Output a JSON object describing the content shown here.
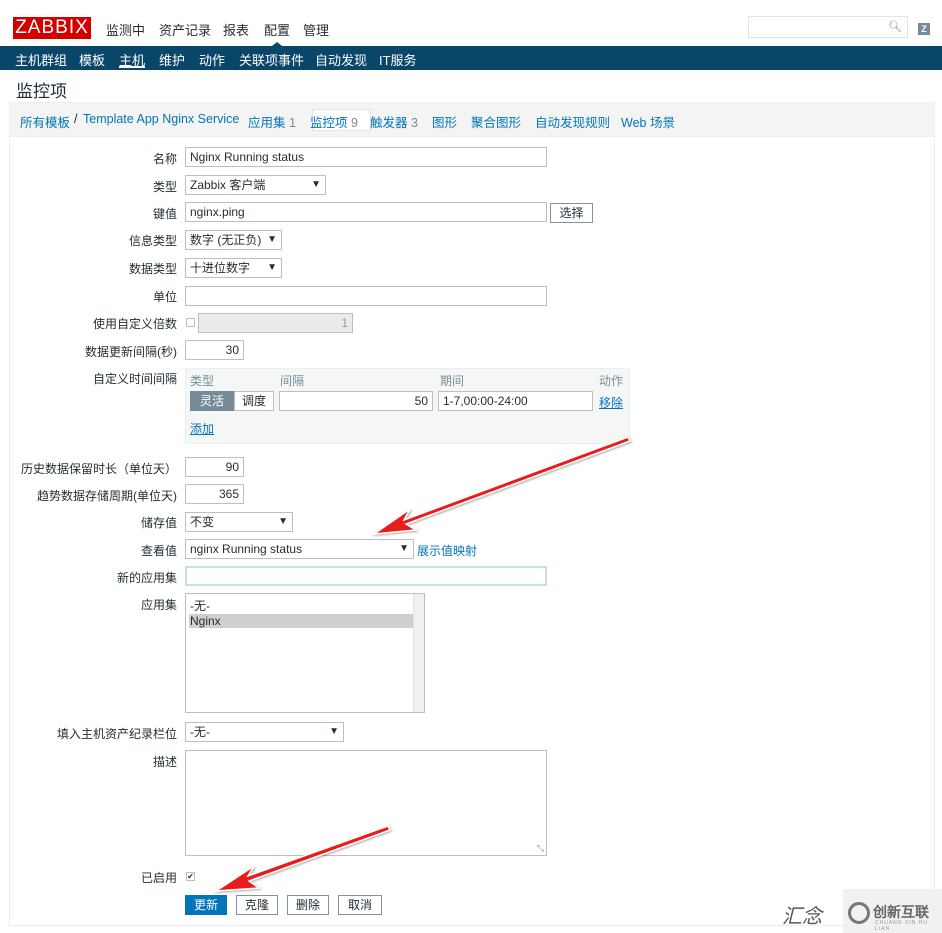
{
  "header": {
    "logo": "ZABBIX",
    "nav": [
      "监测中",
      "资产记录",
      "报表",
      "配置",
      "管理"
    ],
    "search_placeholder": "",
    "help_label": "Z"
  },
  "subnav": [
    "主机群组",
    "模板",
    "主机",
    "维护",
    "动作",
    "关联项事件",
    "自动发现",
    "IT服务"
  ],
  "page_title": "监控项",
  "breadcrumb": {
    "all_templates": "所有模板",
    "separator": "/",
    "template": "Template App Nginx Service",
    "app_set": "应用集",
    "app_set_count": "1",
    "items": "监控项",
    "items_count": "9",
    "triggers": "触发器",
    "triggers_count": "3",
    "graphs": "图形",
    "screens": "聚合图形",
    "discovery": "自动发现规则",
    "web": "Web 场景"
  },
  "form": {
    "name_label": "名称",
    "name_value": "Nginx Running status",
    "type_label": "类型",
    "type_value": "Zabbix 客户端",
    "key_label": "键值",
    "key_value": "nginx.ping",
    "key_select_button": "选择",
    "info_type_label": "信息类型",
    "info_type_value": "数字 (无正负)",
    "data_type_label": "数据类型",
    "data_type_value": "十进位数字",
    "units_label": "单位",
    "units_value": "",
    "multiplier_label": "使用自定义倍数",
    "multiplier_value": "1",
    "interval_label": "数据更新间隔(秒)",
    "interval_value": "30",
    "custom_intervals_label": "自定义时间间隔",
    "ci_head_type": "类型",
    "ci_head_interval": "间隔",
    "ci_head_period": "期间",
    "ci_head_action": "动作",
    "ci_flexible": "灵活",
    "ci_scheduling": "调度",
    "ci_interval_value": "50",
    "ci_period_value": "1-7,00:00-24:00",
    "ci_remove": "移除",
    "ci_add": "添加",
    "history_label": "历史数据保留时长（单位天）",
    "history_value": "90",
    "trends_label": "趋势数据存储周期(单位天)",
    "trends_value": "365",
    "store_label": "储存值",
    "store_value": "不变",
    "show_value_label": "查看值",
    "show_value_value": "nginx Running status",
    "value_mapping_link": "展示值映射",
    "new_app_label": "新的应用集",
    "new_app_value": "",
    "apps_label": "应用集",
    "apps_options": [
      "-无-",
      "Nginx"
    ],
    "inventory_label": "填入主机资产纪录栏位",
    "inventory_value": "-无-",
    "description_label": "描述",
    "description_value": "",
    "enabled_label": "已启用",
    "btn_update": "更新",
    "btn_clone": "克隆",
    "btn_delete": "删除",
    "btn_cancel": "取消"
  },
  "watermark": {
    "brand": "创新互联",
    "sub": "CHUANG XIN HU LIAN",
    "script": "汇念"
  },
  "colors": {
    "brand_red": "#d40000",
    "nav_blue": "#0a466a",
    "link_blue": "#0275b8",
    "arrow_red": "#e81f1f"
  }
}
